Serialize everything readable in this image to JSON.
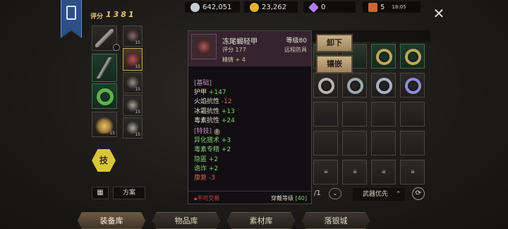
{
  "header": {
    "score_label": "评分",
    "score_value": "1381"
  },
  "currency": [
    {
      "icon": "silver-coin-icon",
      "value": "642,051",
      "color": "#c9ccd1"
    },
    {
      "icon": "gold-coin-icon",
      "value": "23,262",
      "color": "#e6b42e"
    },
    {
      "icon": "diamond-icon",
      "value": "0",
      "color": "#b57de8"
    },
    {
      "icon": "ticket-icon",
      "value": "5",
      "color": "#d4603a"
    }
  ],
  "clock": "18:05",
  "equip_levels": [
    "15",
    "15",
    "15",
    "15",
    "15",
    "15"
  ],
  "tooltip": {
    "name": "冻尾蝎轻甲",
    "level": "等级80",
    "score": "评分 177",
    "class": "远程防具",
    "refine_label": "精铸",
    "refine_value": "+ 4",
    "section_basic": "[基础]",
    "basic_stats": [
      {
        "label": "护甲",
        "value": "+147",
        "kind": "pos"
      },
      {
        "label": "火焰抗性",
        "value": "-12",
        "kind": "neg"
      },
      {
        "label": "冰霜抗性",
        "value": "+13",
        "kind": "pos"
      },
      {
        "label": "毒素抗性",
        "value": "+24",
        "kind": "pos"
      }
    ],
    "section_skill": "[特技]",
    "skill_stats": [
      {
        "label": "异化猎术",
        "value": "+3",
        "kind": "pos"
      },
      {
        "label": "毒素专精",
        "value": "+2",
        "kind": "pos"
      },
      {
        "label": "隐匿",
        "value": "+2",
        "kind": "pos"
      },
      {
        "label": "诡诈",
        "value": "+2",
        "kind": "pos"
      },
      {
        "label": "康复",
        "value": "-3",
        "kind": "neg"
      }
    ],
    "trade": "不可交易",
    "req_label": "穿戴等级",
    "req_value": "[40]"
  },
  "actions": {
    "unequip": "卸下",
    "inlay": "镶嵌"
  },
  "skill_button": "技",
  "plan_button": "方案",
  "page_text": "/1",
  "sort_label": "武器优先",
  "tabs": [
    "装备库",
    "物品库",
    "素材库",
    "落银城"
  ]
}
